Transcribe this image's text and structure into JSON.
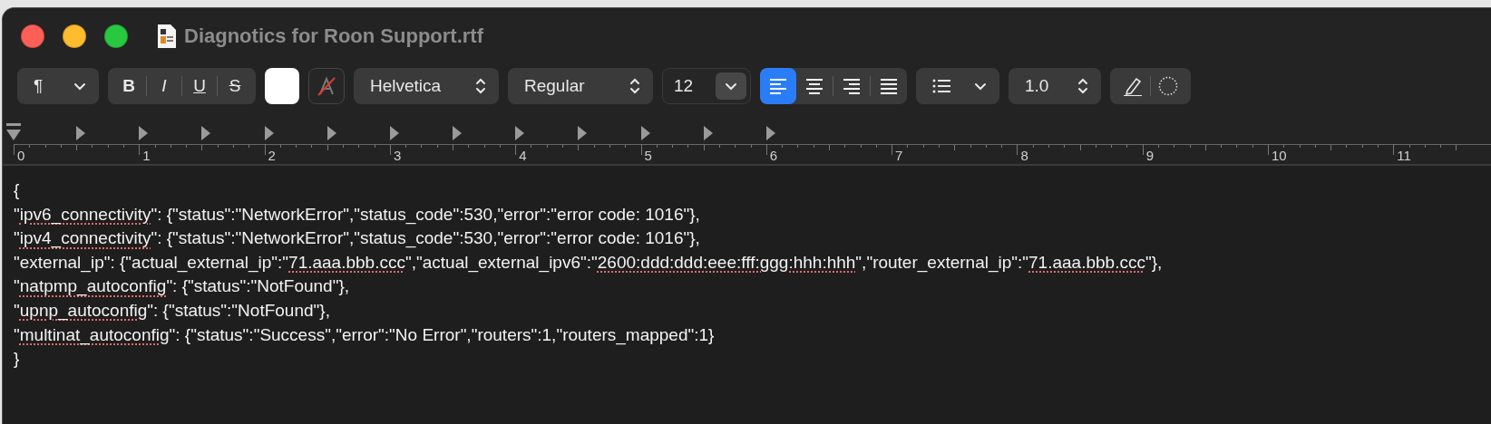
{
  "window": {
    "title": "Diagnotics for Roon Support.rtf"
  },
  "toolbar": {
    "paragraph_style": "¶",
    "text_styles": [
      {
        "label": "B",
        "kind": "bold",
        "selected": false
      },
      {
        "label": "I",
        "kind": "italic",
        "selected": false
      },
      {
        "label": "U",
        "kind": "underline",
        "selected": false
      },
      {
        "label": "S",
        "kind": "strike",
        "selected": false
      }
    ],
    "font_family": "Helvetica",
    "typeface": "Regular",
    "font_size": "12",
    "alignment": [
      {
        "kind": "left",
        "selected": true
      },
      {
        "kind": "center",
        "selected": false
      },
      {
        "kind": "right",
        "selected": false
      },
      {
        "kind": "justify",
        "selected": false
      }
    ],
    "line_spacing": "1.0"
  },
  "ruler": {
    "marks": [
      "0",
      "1",
      "2",
      "3",
      "4",
      "5",
      "6",
      "7",
      "8",
      "9",
      "10",
      "11"
    ]
  },
  "document": {
    "lines": [
      [
        {
          "text": "{",
          "misspelled": false
        }
      ],
      [
        {
          "text": "\"",
          "misspelled": false
        },
        {
          "text": "ipv6_connectivity",
          "misspelled": true
        },
        {
          "text": "\": {\"status\":\"NetworkError\",\"status_code\":530,\"error\":\"error code: 1016\"},",
          "misspelled": false
        }
      ],
      [
        {
          "text": "\"",
          "misspelled": false
        },
        {
          "text": "ipv4_connectivity",
          "misspelled": true
        },
        {
          "text": "\": {\"status\":\"NetworkError\",\"status_code\":530,\"error\":\"error code: 1016\"},",
          "misspelled": false
        }
      ],
      [
        {
          "text": "\"external_ip\": {\"actual_external_ip\":\"",
          "misspelled": false
        },
        {
          "text": "71.aaa.bbb.ccc",
          "misspelled": true
        },
        {
          "text": "\",\"actual_external_ipv6\":\"",
          "misspelled": false
        },
        {
          "text": "2600:ddd:ddd:eee:fff:ggg:hhh:hhh",
          "misspelled": true
        },
        {
          "text": "\",\"router_external_ip\":\"",
          "misspelled": false
        },
        {
          "text": "71.aaa.bbb.ccc",
          "misspelled": true
        },
        {
          "text": "\"},",
          "misspelled": false
        }
      ],
      [
        {
          "text": "\"",
          "misspelled": false
        },
        {
          "text": "natpmp_autoconfig",
          "misspelled": true
        },
        {
          "text": "\": {\"status\":\"NotFound\"},",
          "misspelled": false
        }
      ],
      [
        {
          "text": "\"",
          "misspelled": false
        },
        {
          "text": "upnp_autoconfig",
          "misspelled": true
        },
        {
          "text": "\": {\"status\":\"NotFound\"},",
          "misspelled": false
        }
      ],
      [
        {
          "text": "\"",
          "misspelled": false
        },
        {
          "text": "multinat_autoconfig",
          "misspelled": true
        },
        {
          "text": "\": {\"status\":\"Success\",\"error\":\"No Error\",\"routers\":1,\"routers_mapped\":1}",
          "misspelled": false
        }
      ],
      [
        {
          "text": "}",
          "misspelled": false
        }
      ]
    ]
  }
}
